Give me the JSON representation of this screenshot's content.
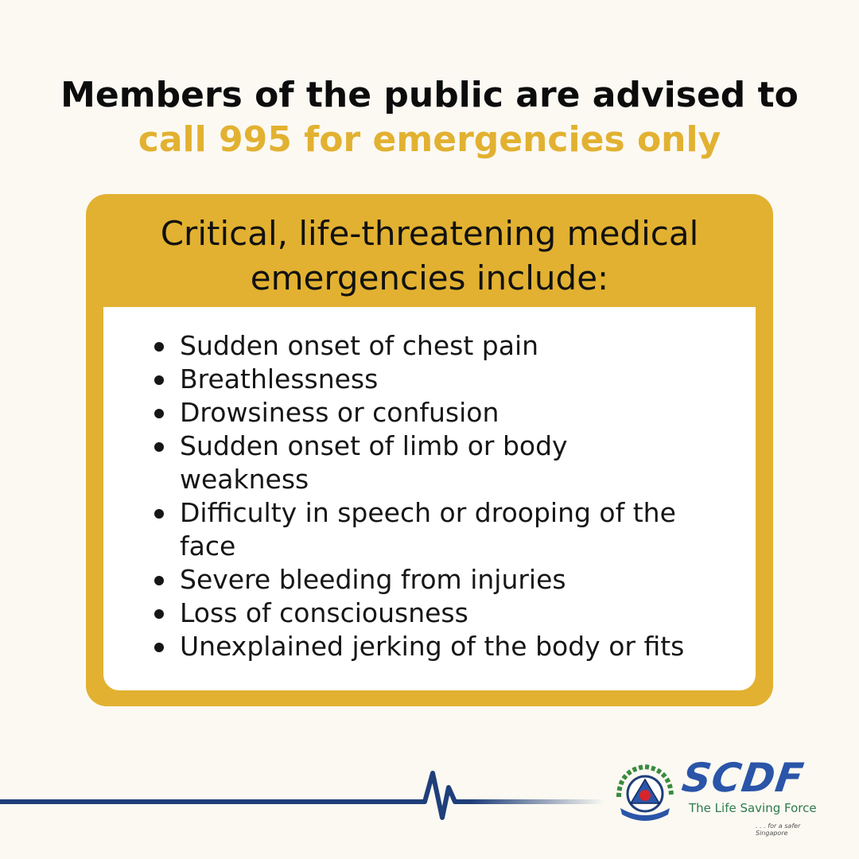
{
  "headline": {
    "line1": "Members of the public are advised to",
    "line2": "call 995 for emergencies only"
  },
  "card": {
    "title_line1": "Critical, life-threatening medical",
    "title_line2": "emergencies include:",
    "items": [
      {
        "line1": "Sudden onset of chest pain",
        "line2": ""
      },
      {
        "line1": "Breathlessness",
        "line2": ""
      },
      {
        "line1": "Drowsiness or confusion",
        "line2": ""
      },
      {
        "line1": "Sudden onset of limb or body",
        "line2": "weakness"
      },
      {
        "line1": "Difficulty in speech or drooping of the",
        "line2": "face"
      },
      {
        "line1": "Severe bleeding from injuries",
        "line2": ""
      },
      {
        "line1": "Loss of consciousness",
        "line2": ""
      },
      {
        "line1": "Unexplained jerking of the body or fits",
        "line2": ""
      }
    ]
  },
  "footer": {
    "brand": "SCDF",
    "tagline": "The Life Saving Force",
    "subtag": ". . . for a safer Singapore",
    "icons": [
      "heartbeat-line-icon",
      "scdf-emblem-icon"
    ]
  },
  "colors": {
    "accent": "#e2b131",
    "navy": "#1f3f7a",
    "brand_blue": "#2a55a8",
    "background": "#fbf9f2"
  }
}
